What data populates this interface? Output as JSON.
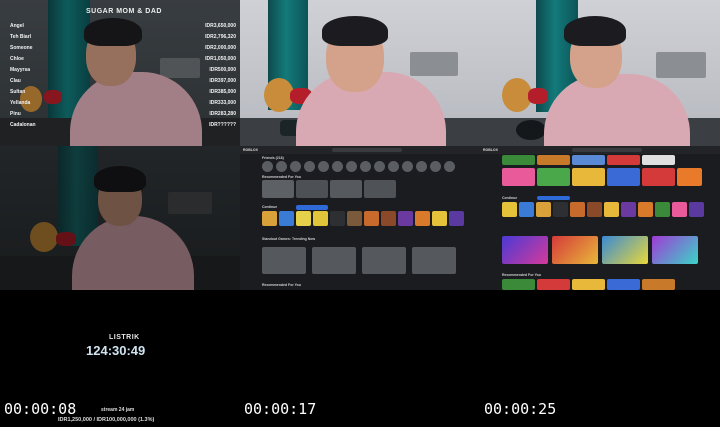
{
  "leaderboard": {
    "title": "SUGAR MOM & DAD",
    "rows": [
      {
        "name": "Angel",
        "amount": "IDR3,650,000"
      },
      {
        "name": "Teh Biarl",
        "amount": "IDR2,796,320"
      },
      {
        "name": "Someone",
        "amount": "IDR2,000,000"
      },
      {
        "name": "Chloe",
        "amount": "IDR1,050,000"
      },
      {
        "name": "Mayyrsa",
        "amount": "IDR500,000"
      },
      {
        "name": "Clau",
        "amount": "IDR397,000"
      },
      {
        "name": "Sultan",
        "amount": "IDR385,000"
      },
      {
        "name": "Yellanda",
        "amount": "IDR333,000"
      },
      {
        "name": "Pinu",
        "amount": "IDR283,280"
      },
      {
        "name": "Cadalonan",
        "amount": "IDR??????"
      }
    ]
  },
  "roblox_home": {
    "logo": "ROBLOX",
    "friends_label": "Friends (218)",
    "recommended_label": "Recommended For You",
    "continue_label": "Continue",
    "sponsored_label": "Standout Games: Trending Now",
    "recommended_label_2": "Recommended For You"
  },
  "roblox_games": {
    "logo": "ROBLOX",
    "continue_label": "Continue",
    "recommended_label": "Recommended For You"
  },
  "listrik": {
    "label": "LISTRIK",
    "time": "124:30:49"
  },
  "stream": {
    "label": "stream 24 jam",
    "progress": "IDR1,250,000 / IDR100,000,000 (1.3%)"
  },
  "timestamps": [
    "00:00:08",
    "00:00:17",
    "00:00:25"
  ]
}
